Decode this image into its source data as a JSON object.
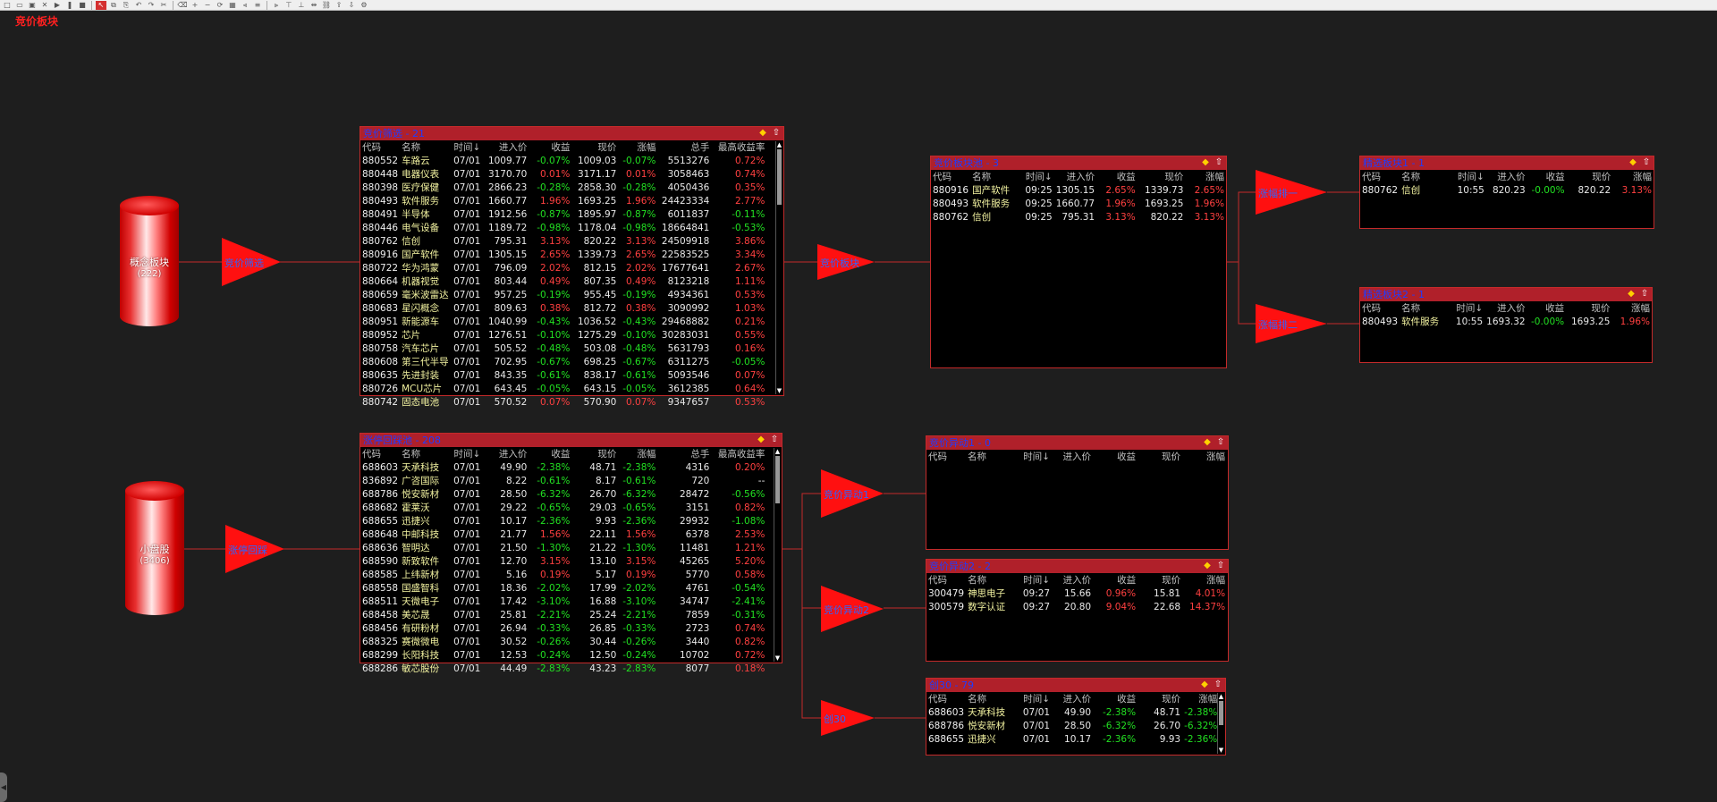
{
  "app": {
    "title": "竞价板块"
  },
  "toolbar": [
    "new-icon",
    "open-icon",
    "save-icon",
    "close-icon",
    "run-icon",
    "pause-icon",
    "stop-icon",
    "select-icon",
    "copy-icon",
    "paste-icon",
    "undo-icon",
    "redo-icon",
    "cut-icon",
    "delete-icon",
    "zoom-in-icon",
    "zoom-out-icon",
    "refresh-icon",
    "grid-icon",
    "align-left-icon",
    "align-center-icon",
    "align-right-icon",
    "align-top-icon",
    "align-bottom-icon",
    "distribute-icon",
    "link-icon",
    "export-icon",
    "import-icon",
    "settings-icon"
  ],
  "colors": {
    "accent": "#b0202a",
    "up": "#ff4040",
    "down": "#22e022",
    "title": "#1f3cff",
    "name": "#f2f2a0"
  },
  "sources": [
    {
      "label": "概念板块",
      "count": "(222)"
    },
    {
      "label": "小盘股",
      "count": "(3406)"
    }
  ],
  "filters": {
    "f1": "竞价筛选",
    "f2": "涨停回踩",
    "f3": "竞价板块",
    "f4": "涨幅排一",
    "f5": "涨幅排二",
    "f6": "竞价异动1",
    "f7": "竞价异动2",
    "f8": "创30"
  },
  "panels": {
    "screen": {
      "title": "竞价筛选 - 21",
      "columns": [
        "代码",
        "名称",
        "时间↓",
        "进入价",
        "收益",
        "现价",
        "涨幅",
        "总手",
        "最高收益率"
      ],
      "rows": [
        [
          "880552",
          "车路云",
          "07/01",
          "1009.77",
          "-0.07%",
          "1009.03",
          "-0.07%",
          "5513276",
          "0.72%"
        ],
        [
          "880448",
          "电器仪表",
          "07/01",
          "3170.70",
          "0.01%",
          "3171.17",
          "0.01%",
          "3058463",
          "0.74%"
        ],
        [
          "880398",
          "医疗保健",
          "07/01",
          "2866.23",
          "-0.28%",
          "2858.30",
          "-0.28%",
          "4050436",
          "0.35%"
        ],
        [
          "880493",
          "软件服务",
          "07/01",
          "1660.77",
          "1.96%",
          "1693.25",
          "1.96%",
          "24423334",
          "2.77%"
        ],
        [
          "880491",
          "半导体",
          "07/01",
          "1912.56",
          "-0.87%",
          "1895.97",
          "-0.87%",
          "6011837",
          "-0.11%"
        ],
        [
          "880446",
          "电气设备",
          "07/01",
          "1189.72",
          "-0.98%",
          "1178.04",
          "-0.98%",
          "18664841",
          "-0.53%"
        ],
        [
          "880762",
          "信创",
          "07/01",
          "795.31",
          "3.13%",
          "820.22",
          "3.13%",
          "24509918",
          "3.86%"
        ],
        [
          "880916",
          "国产软件",
          "07/01",
          "1305.15",
          "2.65%",
          "1339.73",
          "2.65%",
          "22583525",
          "3.34%"
        ],
        [
          "880722",
          "华为鸿蒙",
          "07/01",
          "796.09",
          "2.02%",
          "812.15",
          "2.02%",
          "17677641",
          "2.67%"
        ],
        [
          "880664",
          "机器视觉",
          "07/01",
          "803.44",
          "0.49%",
          "807.35",
          "0.49%",
          "8123218",
          "1.11%"
        ],
        [
          "880659",
          "毫米波雷达",
          "07/01",
          "957.25",
          "-0.19%",
          "955.45",
          "-0.19%",
          "4934361",
          "0.53%"
        ],
        [
          "880683",
          "星闪概念",
          "07/01",
          "809.63",
          "0.38%",
          "812.72",
          "0.38%",
          "3090992",
          "1.03%"
        ],
        [
          "880951",
          "新能源车",
          "07/01",
          "1040.99",
          "-0.43%",
          "1036.52",
          "-0.43%",
          "29468882",
          "0.21%"
        ],
        [
          "880952",
          "芯片",
          "07/01",
          "1276.51",
          "-0.10%",
          "1275.29",
          "-0.10%",
          "30283031",
          "0.55%"
        ],
        [
          "880758",
          "汽车芯片",
          "07/01",
          "505.52",
          "-0.48%",
          "503.08",
          "-0.48%",
          "5631793",
          "0.16%"
        ],
        [
          "880608",
          "第三代半导",
          "07/01",
          "702.95",
          "-0.67%",
          "698.25",
          "-0.67%",
          "6311275",
          "-0.05%"
        ],
        [
          "880635",
          "先进封装",
          "07/01",
          "843.35",
          "-0.61%",
          "838.17",
          "-0.61%",
          "5093546",
          "0.07%"
        ],
        [
          "880726",
          "MCU芯片",
          "07/01",
          "643.45",
          "-0.05%",
          "643.15",
          "-0.05%",
          "3612385",
          "0.64%"
        ],
        [
          "880742",
          "固态电池",
          "07/01",
          "570.52",
          "0.07%",
          "570.90",
          "0.07%",
          "9347657",
          "0.53%"
        ]
      ]
    },
    "limitup": {
      "title": "涨停回踩池 - 208",
      "columns": [
        "代码",
        "名称",
        "时间↓",
        "进入价",
        "收益",
        "现价",
        "涨幅",
        "总手",
        "最高收益率"
      ],
      "rows": [
        [
          "688603",
          "天承科技",
          "07/01",
          "49.90",
          "-2.38%",
          "48.71",
          "-2.38%",
          "4316",
          "0.20%"
        ],
        [
          "836892",
          "广咨国际",
          "07/01",
          "8.22",
          "-0.61%",
          "8.17",
          "-0.61%",
          "720",
          "--"
        ],
        [
          "688786",
          "悦安新材",
          "07/01",
          "28.50",
          "-6.32%",
          "26.70",
          "-6.32%",
          "28472",
          "-0.56%"
        ],
        [
          "688682",
          "霍莱沃",
          "07/01",
          "29.22",
          "-0.65%",
          "29.03",
          "-0.65%",
          "3151",
          "0.82%"
        ],
        [
          "688655",
          "迅捷兴",
          "07/01",
          "10.17",
          "-2.36%",
          "9.93",
          "-2.36%",
          "29932",
          "-1.08%"
        ],
        [
          "688648",
          "中邮科技",
          "07/01",
          "21.77",
          "1.56%",
          "22.11",
          "1.56%",
          "6378",
          "2.53%"
        ],
        [
          "688636",
          "智明达",
          "07/01",
          "21.50",
          "-1.30%",
          "21.22",
          "-1.30%",
          "11481",
          "1.21%"
        ],
        [
          "688590",
          "新致软件",
          "07/01",
          "12.70",
          "3.15%",
          "13.10",
          "3.15%",
          "45265",
          "5.20%"
        ],
        [
          "688585",
          "上纬新材",
          "07/01",
          "5.16",
          "0.19%",
          "5.17",
          "0.19%",
          "5770",
          "0.58%"
        ],
        [
          "688558",
          "国盛智科",
          "07/01",
          "18.36",
          "-2.02%",
          "17.99",
          "-2.02%",
          "4761",
          "-0.54%"
        ],
        [
          "688511",
          "天微电子",
          "07/01",
          "17.42",
          "-3.10%",
          "16.88",
          "-3.10%",
          "34747",
          "-2.41%"
        ],
        [
          "688458",
          "美芯晟",
          "07/01",
          "25.81",
          "-2.21%",
          "25.24",
          "-2.21%",
          "7859",
          "-0.31%"
        ],
        [
          "688456",
          "有研粉材",
          "07/01",
          "26.94",
          "-0.33%",
          "26.85",
          "-0.33%",
          "2723",
          "0.74%"
        ],
        [
          "688325",
          "赛微微电",
          "07/01",
          "30.52",
          "-0.26%",
          "30.44",
          "-0.26%",
          "3440",
          "0.82%"
        ],
        [
          "688299",
          "长阳科技",
          "07/01",
          "12.53",
          "-0.24%",
          "12.50",
          "-0.24%",
          "10702",
          "0.72%"
        ],
        [
          "688286",
          "敏芯股份",
          "07/01",
          "44.49",
          "-2.83%",
          "43.23",
          "-2.83%",
          "8077",
          "0.18%"
        ]
      ]
    },
    "pool": {
      "title": "竞价板块池 - 3",
      "columns": [
        "代码",
        "名称",
        "时间↓",
        "进入价",
        "收益",
        "现价",
        "涨幅"
      ],
      "rows": [
        [
          "880916",
          "国产软件",
          "09:25",
          "1305.15",
          "2.65%",
          "1339.73",
          "2.65%"
        ],
        [
          "880493",
          "软件服务",
          "09:25",
          "1660.77",
          "1.96%",
          "1693.25",
          "1.96%"
        ],
        [
          "880762",
          "信创",
          "09:25",
          "795.31",
          "3.13%",
          "820.22",
          "3.13%"
        ]
      ]
    },
    "pick1": {
      "title": "精选板块1 - 1",
      "columns": [
        "代码",
        "名称",
        "时间↓",
        "进入价",
        "收益",
        "现价",
        "涨幅"
      ],
      "rows": [
        [
          "880762",
          "信创",
          "10:55",
          "820.23",
          "-0.00%",
          "820.22",
          "3.13%"
        ]
      ]
    },
    "pick2": {
      "title": "精选板块2 - 1",
      "columns": [
        "代码",
        "名称",
        "时间↓",
        "进入价",
        "收益",
        "现价",
        "涨幅"
      ],
      "rows": [
        [
          "880493",
          "软件服务",
          "10:55",
          "1693.32",
          "-0.00%",
          "1693.25",
          "1.96%"
        ]
      ]
    },
    "move1": {
      "title": "竞价异动1 - 0",
      "columns": [
        "代码",
        "名称",
        "时间↓",
        "进入价",
        "收益",
        "现价",
        "涨幅"
      ],
      "rows": []
    },
    "move2": {
      "title": "竞价异动2 - 2",
      "columns": [
        "代码",
        "名称",
        "时间↓",
        "进入价",
        "收益",
        "现价",
        "涨幅"
      ],
      "rows": [
        [
          "300479",
          "神思电子",
          "09:27",
          "15.66",
          "0.96%",
          "15.81",
          "4.01%"
        ],
        [
          "300579",
          "数字认证",
          "09:27",
          "20.80",
          "9.04%",
          "22.68",
          "14.37%"
        ]
      ]
    },
    "cy30": {
      "title": "创30 - 79",
      "columns": [
        "代码",
        "名称",
        "时间↓",
        "进入价",
        "收益",
        "现价",
        "涨幅"
      ],
      "rows": [
        [
          "688603",
          "天承科技",
          "07/01",
          "49.90",
          "-2.38%",
          "48.71",
          "-2.38%"
        ],
        [
          "688786",
          "悦安新材",
          "07/01",
          "28.50",
          "-6.32%",
          "26.70",
          "-6.32%"
        ],
        [
          "688655",
          "迅捷兴",
          "07/01",
          "10.17",
          "-2.36%",
          "9.93",
          "-2.36%"
        ]
      ]
    }
  }
}
